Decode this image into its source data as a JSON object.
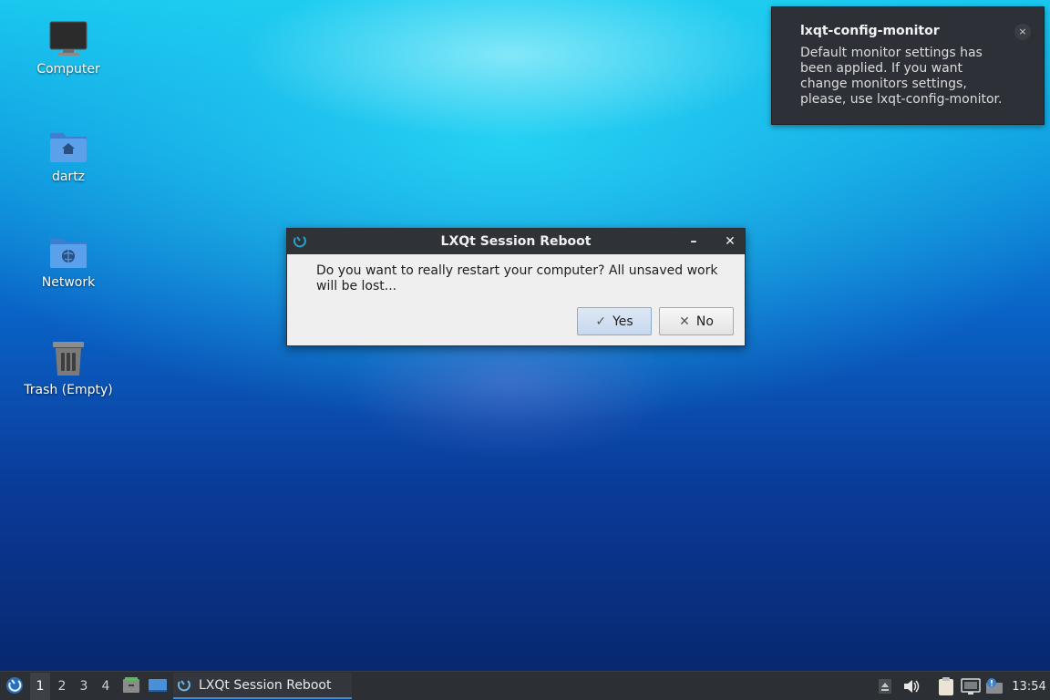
{
  "desktop": {
    "icons": [
      {
        "label": "Computer",
        "icon": "monitor-icon"
      },
      {
        "label": "dartz",
        "icon": "home-folder-icon"
      },
      {
        "label": "Network",
        "icon": "network-folder-icon"
      },
      {
        "label": "Trash (Empty)",
        "icon": "trash-icon"
      }
    ]
  },
  "notification": {
    "title": "lxqt-config-monitor",
    "body": "Default monitor settings has been applied. If you want change monitors settings, please, use lxqt-config-monitor.",
    "close_glyph": "×"
  },
  "dialog": {
    "title": "LXQt Session Reboot",
    "message": "Do you want to really restart your computer? All unsaved work will be lost...",
    "minimize_glyph": "–",
    "close_glyph": "✕",
    "yes_label": "Yes",
    "no_label": "No",
    "yes_glyph": "✓",
    "no_glyph": "✕"
  },
  "taskbar": {
    "desktops": [
      "1",
      "2",
      "3",
      "4"
    ],
    "active_desktop": "1",
    "task_label": "LXQt Session Reboot",
    "clock": "13:54"
  },
  "colors": {
    "taskbar_bg": "#2c2f34",
    "notification_bg": "#2d3036",
    "dialog_titlebar": "#2f3236",
    "accent": "#3b8ed8"
  }
}
